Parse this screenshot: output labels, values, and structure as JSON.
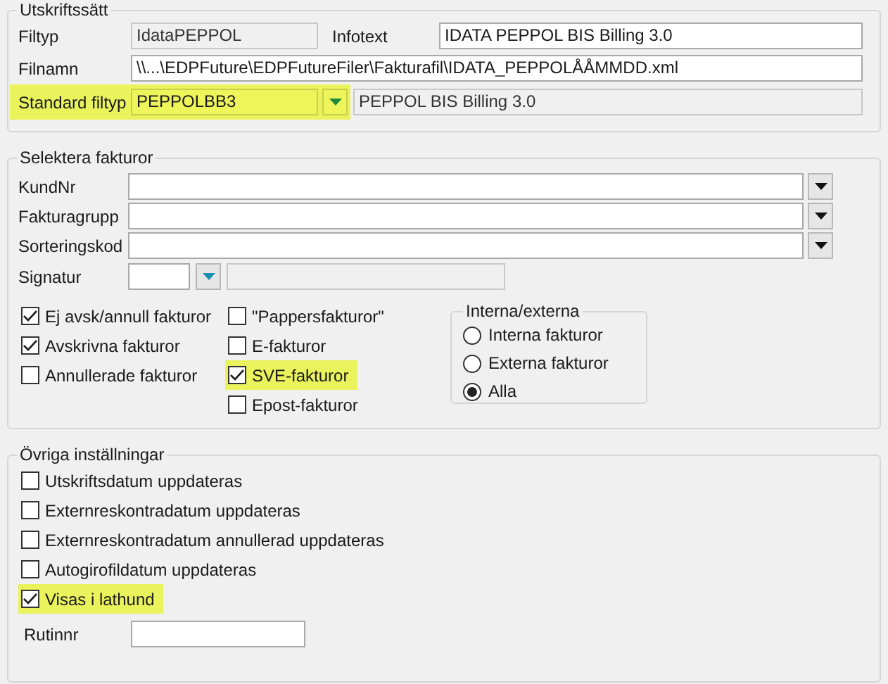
{
  "output_settings": {
    "title": "Utskriftssätt",
    "filtyp": {
      "label": "Filtyp",
      "value": "IdataPEPPOL",
      "readonly": true
    },
    "infotext": {
      "label": "Infotext",
      "value": "IDATA PEPPOL BIS Billing 3.0",
      "readonly": false
    },
    "filnamn": {
      "label": "Filnamn",
      "value": "\\\\...\\EDPFuture\\EDPFutureFiler\\Fakturafil\\IDATA_PEPPOLÅÅMMDD.xml",
      "readonly": false
    },
    "standard_filtyp": {
      "label": "Standard filtyp",
      "value": "PEPPOLBB3",
      "description": "PEPPOL BIS Billing 3.0",
      "highlighted": true
    }
  },
  "select_invoices": {
    "title": "Selektera fakturor",
    "fields": [
      {
        "label": "KundNr"
      },
      {
        "label": "Fakturagrupp"
      },
      {
        "label": "Sorteringskod"
      }
    ],
    "signatur": {
      "label": "Signatur"
    },
    "checkboxes_left": [
      {
        "label": "Ej avsk/annull fakturor",
        "checked": true,
        "highlighted": false
      },
      {
        "label": "Avskrivna fakturor",
        "checked": true,
        "highlighted": false
      },
      {
        "label": "Annullerade fakturor",
        "checked": false,
        "highlighted": false
      }
    ],
    "checkboxes_right": [
      {
        "label": "\"Pappersfakturor\"",
        "checked": false,
        "highlighted": false
      },
      {
        "label": "E-fakturor",
        "checked": false,
        "highlighted": false
      },
      {
        "label": "SVE-fakturor",
        "checked": true,
        "highlighted": true
      },
      {
        "label": "Epost-fakturor",
        "checked": false,
        "highlighted": false
      }
    ],
    "radio_group": {
      "title": "Interna/externa",
      "options": [
        {
          "label": "Interna fakturor",
          "selected": false
        },
        {
          "label": "Externa fakturor",
          "selected": false
        },
        {
          "label": "Alla",
          "selected": true
        }
      ]
    }
  },
  "other_settings": {
    "title": "Övriga inställningar",
    "checkboxes": [
      {
        "label": "Utskriftsdatum uppdateras",
        "checked": false,
        "highlighted": false
      },
      {
        "label": "Externreskontradatum uppdateras",
        "checked": false,
        "highlighted": false
      },
      {
        "label": "Externreskontradatum annullerad uppdateras",
        "checked": false,
        "highlighted": false
      },
      {
        "label": "Autogirofildatum uppdateras",
        "checked": false,
        "highlighted": false
      },
      {
        "label": "Visas i lathund",
        "checked": true,
        "highlighted": true
      }
    ],
    "rutinnr": {
      "label": "Rutinnr"
    }
  }
}
